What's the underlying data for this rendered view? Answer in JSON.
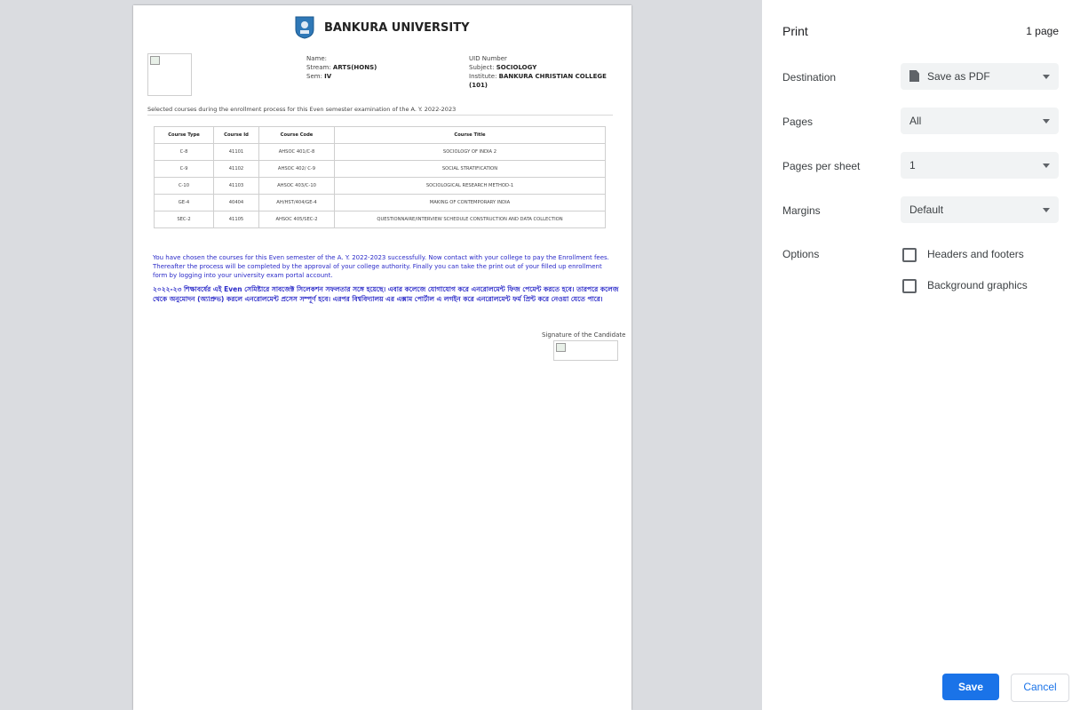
{
  "document": {
    "university_name": "BANKURA UNIVERSITY",
    "student": {
      "name_label": "Name:",
      "stream_label": "Stream:",
      "stream": "ARTS(HONS)",
      "sem_label": "Sem:",
      "sem": "IV",
      "uid_label": "UID Number",
      "subject_label": "Subject:",
      "subject": "SOCIOLOGY",
      "institute_label": "Institute:",
      "institute": "BANKURA CHRISTIAN COLLEGE (101)"
    },
    "selected_courses_text": "Selected courses during the enrollment process for this Even semester examination of the A. Y. 2022-2023",
    "table": {
      "headers": [
        "Course Type",
        "Course Id",
        "Course Code",
        "Course Title"
      ],
      "rows": [
        [
          "C-8",
          "41101",
          "AHSOC 401/C-8",
          "SOCIOLOGY OF INDIA 2"
        ],
        [
          "C-9",
          "41102",
          "AHSOC 402/ C-9",
          "SOCIAL STRATIFICATION"
        ],
        [
          "C-10",
          "41103",
          "AHSOC 403/C-10",
          "SOCIOLOGICAL RESEARCH METHOD-1"
        ],
        [
          "GE-4",
          "40404",
          "AH/HST/404/GE-4",
          "MAKING OF CONTEMPORARY INDIA"
        ],
        [
          "SEC-2",
          "41105",
          "AHSOC 405/SEC-2",
          "QUESTIONNAIRE/INTERVIEW SCHEDULE CONSTRUCTION AND DATA COLLECTION"
        ]
      ]
    },
    "message_en": "You have chosen the courses for this Even semester of the A. Y. 2022-2023 successfully. Now contact with your college to pay the Enrollment fees. Thereafter the process will be completed by the approval of your college authority. Finally you can take the print out of your filled up enrollment form by logging into your university exam portal account.",
    "message_bn": "২০২২-২৩ শিক্ষাবর্ষের এই Even সেমিষ্টারে সাবজেক্ট সিলেকশন সফলতার সঙ্গে হয়েছে। এবার কলেজে যোগাযোগ করে এনরোলমেন্ট ফিজ পেমেন্ট করতে হবে। তারপরে কলেজ থেকে অনুমোদন (অ্যাপ্রুভ) করলে এনরোলমেন্ট প্রসেস সম্পূর্ণ হবে। এরপর বিশ্ববিদ্যালয় এর এক্সাম পোর্টাল এ লগইন করে এনরোলমেন্ট ফর্ম প্রিন্ট করে নেওয়া যেতে পারে।",
    "signature_label": "Signature of the Candidate"
  },
  "print_panel": {
    "title": "Print",
    "page_count": "1 page",
    "destination_label": "Destination",
    "destination_value": "Save as PDF",
    "destination_icon": "document-icon",
    "pages_label": "Pages",
    "pages_value": "All",
    "pages_per_sheet_label": "Pages per sheet",
    "pages_per_sheet_value": "1",
    "margins_label": "Margins",
    "margins_value": "Default",
    "options_label": "Options",
    "headers_footers_label": "Headers and footers",
    "headers_footers_checked": false,
    "background_graphics_label": "Background graphics",
    "background_graphics_checked": false,
    "save_label": "Save",
    "cancel_label": "Cancel"
  },
  "colors": {
    "accent": "#1a73e8",
    "preview_bg": "#dadce0",
    "message_text": "#2a2ac8"
  }
}
